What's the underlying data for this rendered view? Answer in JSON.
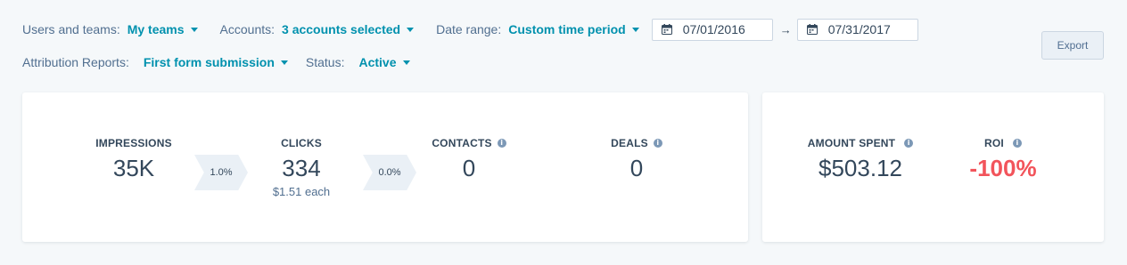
{
  "filters": {
    "users_label": "Users and teams:",
    "users_value": "My teams",
    "accounts_label": "Accounts:",
    "accounts_value": "3 accounts selected",
    "date_label": "Date range:",
    "date_value": "Custom time period",
    "start_date": "07/01/2016",
    "end_date": "07/31/2017",
    "attribution_label": "Attribution Reports:",
    "attribution_value": "First form submission",
    "status_label": "Status:",
    "status_value": "Active"
  },
  "export_label": "Export",
  "funnel": {
    "impressions": {
      "label": "IMPRESSIONS",
      "value": "35K"
    },
    "rate1": "1.0%",
    "clicks": {
      "label": "CLICKS",
      "value": "334",
      "sub": "$1.51 each"
    },
    "rate2": "0.0%",
    "contacts": {
      "label": "CONTACTS",
      "value": "0"
    },
    "deals": {
      "label": "DEALS",
      "value": "0"
    }
  },
  "summary": {
    "amount_spent": {
      "label": "AMOUNT SPENT",
      "value": "$503.12"
    },
    "roi": {
      "label": "ROI",
      "value": "-100%"
    }
  },
  "icons": {
    "info": "i",
    "arrow": "→"
  },
  "colors": {
    "accent": "#0091ae",
    "negative": "#f2545b",
    "text": "#33475b"
  }
}
